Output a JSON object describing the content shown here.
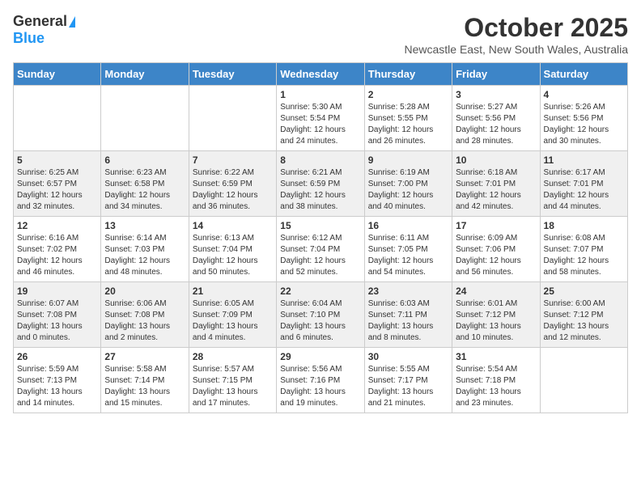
{
  "logo": {
    "general": "General",
    "blue": "Blue"
  },
  "header": {
    "month": "October 2025",
    "location": "Newcastle East, New South Wales, Australia"
  },
  "weekdays": [
    "Sunday",
    "Monday",
    "Tuesday",
    "Wednesday",
    "Thursday",
    "Friday",
    "Saturday"
  ],
  "weeks": [
    [
      {
        "day": "",
        "info": ""
      },
      {
        "day": "",
        "info": ""
      },
      {
        "day": "",
        "info": ""
      },
      {
        "day": "1",
        "info": "Sunrise: 5:30 AM\nSunset: 5:54 PM\nDaylight: 12 hours\nand 24 minutes."
      },
      {
        "day": "2",
        "info": "Sunrise: 5:28 AM\nSunset: 5:55 PM\nDaylight: 12 hours\nand 26 minutes."
      },
      {
        "day": "3",
        "info": "Sunrise: 5:27 AM\nSunset: 5:56 PM\nDaylight: 12 hours\nand 28 minutes."
      },
      {
        "day": "4",
        "info": "Sunrise: 5:26 AM\nSunset: 5:56 PM\nDaylight: 12 hours\nand 30 minutes."
      }
    ],
    [
      {
        "day": "5",
        "info": "Sunrise: 6:25 AM\nSunset: 6:57 PM\nDaylight: 12 hours\nand 32 minutes."
      },
      {
        "day": "6",
        "info": "Sunrise: 6:23 AM\nSunset: 6:58 PM\nDaylight: 12 hours\nand 34 minutes."
      },
      {
        "day": "7",
        "info": "Sunrise: 6:22 AM\nSunset: 6:59 PM\nDaylight: 12 hours\nand 36 minutes."
      },
      {
        "day": "8",
        "info": "Sunrise: 6:21 AM\nSunset: 6:59 PM\nDaylight: 12 hours\nand 38 minutes."
      },
      {
        "day": "9",
        "info": "Sunrise: 6:19 AM\nSunset: 7:00 PM\nDaylight: 12 hours\nand 40 minutes."
      },
      {
        "day": "10",
        "info": "Sunrise: 6:18 AM\nSunset: 7:01 PM\nDaylight: 12 hours\nand 42 minutes."
      },
      {
        "day": "11",
        "info": "Sunrise: 6:17 AM\nSunset: 7:01 PM\nDaylight: 12 hours\nand 44 minutes."
      }
    ],
    [
      {
        "day": "12",
        "info": "Sunrise: 6:16 AM\nSunset: 7:02 PM\nDaylight: 12 hours\nand 46 minutes."
      },
      {
        "day": "13",
        "info": "Sunrise: 6:14 AM\nSunset: 7:03 PM\nDaylight: 12 hours\nand 48 minutes."
      },
      {
        "day": "14",
        "info": "Sunrise: 6:13 AM\nSunset: 7:04 PM\nDaylight: 12 hours\nand 50 minutes."
      },
      {
        "day": "15",
        "info": "Sunrise: 6:12 AM\nSunset: 7:04 PM\nDaylight: 12 hours\nand 52 minutes."
      },
      {
        "day": "16",
        "info": "Sunrise: 6:11 AM\nSunset: 7:05 PM\nDaylight: 12 hours\nand 54 minutes."
      },
      {
        "day": "17",
        "info": "Sunrise: 6:09 AM\nSunset: 7:06 PM\nDaylight: 12 hours\nand 56 minutes."
      },
      {
        "day": "18",
        "info": "Sunrise: 6:08 AM\nSunset: 7:07 PM\nDaylight: 12 hours\nand 58 minutes."
      }
    ],
    [
      {
        "day": "19",
        "info": "Sunrise: 6:07 AM\nSunset: 7:08 PM\nDaylight: 13 hours\nand 0 minutes."
      },
      {
        "day": "20",
        "info": "Sunrise: 6:06 AM\nSunset: 7:08 PM\nDaylight: 13 hours\nand 2 minutes."
      },
      {
        "day": "21",
        "info": "Sunrise: 6:05 AM\nSunset: 7:09 PM\nDaylight: 13 hours\nand 4 minutes."
      },
      {
        "day": "22",
        "info": "Sunrise: 6:04 AM\nSunset: 7:10 PM\nDaylight: 13 hours\nand 6 minutes."
      },
      {
        "day": "23",
        "info": "Sunrise: 6:03 AM\nSunset: 7:11 PM\nDaylight: 13 hours\nand 8 minutes."
      },
      {
        "day": "24",
        "info": "Sunrise: 6:01 AM\nSunset: 7:12 PM\nDaylight: 13 hours\nand 10 minutes."
      },
      {
        "day": "25",
        "info": "Sunrise: 6:00 AM\nSunset: 7:12 PM\nDaylight: 13 hours\nand 12 minutes."
      }
    ],
    [
      {
        "day": "26",
        "info": "Sunrise: 5:59 AM\nSunset: 7:13 PM\nDaylight: 13 hours\nand 14 minutes."
      },
      {
        "day": "27",
        "info": "Sunrise: 5:58 AM\nSunset: 7:14 PM\nDaylight: 13 hours\nand 15 minutes."
      },
      {
        "day": "28",
        "info": "Sunrise: 5:57 AM\nSunset: 7:15 PM\nDaylight: 13 hours\nand 17 minutes."
      },
      {
        "day": "29",
        "info": "Sunrise: 5:56 AM\nSunset: 7:16 PM\nDaylight: 13 hours\nand 19 minutes."
      },
      {
        "day": "30",
        "info": "Sunrise: 5:55 AM\nSunset: 7:17 PM\nDaylight: 13 hours\nand 21 minutes."
      },
      {
        "day": "31",
        "info": "Sunrise: 5:54 AM\nSunset: 7:18 PM\nDaylight: 13 hours\nand 23 minutes."
      },
      {
        "day": "",
        "info": ""
      }
    ]
  ]
}
